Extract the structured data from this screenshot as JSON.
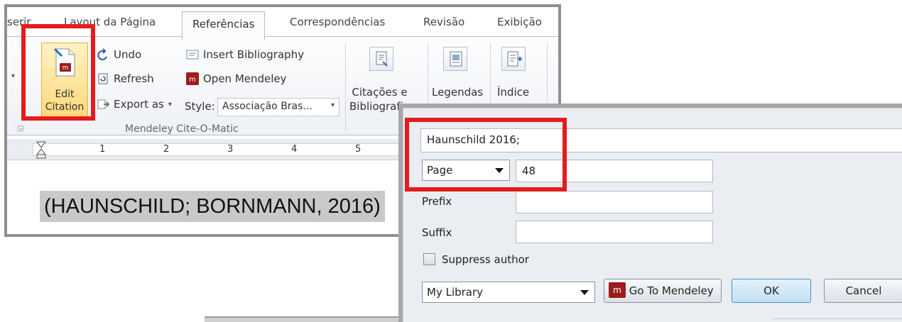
{
  "tabs": [
    "serir",
    "Layout da Página",
    "Referências",
    "Correspondências",
    "Revisão",
    "Exibição"
  ],
  "ribbon": {
    "edit_citation_line1": "Edit",
    "edit_citation_line2": "Citation",
    "undo": "Undo",
    "refresh": "Refresh",
    "export_as": "Export as",
    "insert_bibliography": "Insert Bibliography",
    "open_mendeley": "Open Mendeley",
    "style_label": "Style:",
    "style_value": "Associação Bras...",
    "group_label": "Mendeley Cite-O-Matic",
    "citacoes_line1": "Citações e",
    "citacoes_line2": "Bibliografia",
    "legendas": "Legendas",
    "indice": "Índice"
  },
  "ruler": {
    "numbers": [
      "1",
      "2",
      "3",
      "4",
      "5"
    ]
  },
  "document": {
    "citation_text": "(HAUNSCHILD; BORNMANN, 2016)"
  },
  "dialog": {
    "citation_field": "Haunschild 2016;",
    "locator_type": "Page",
    "locator_value": "48",
    "prefix_label": "Prefix",
    "suffix_label": "Suffix",
    "suppress_author": "Suppress author",
    "library": "My Library",
    "go_to_mendeley": "Go To Mendeley",
    "ok": "OK",
    "cancel": "Cancel"
  },
  "colors": {
    "highlight": "#e51c1c",
    "mendeley_red": "#9c1c1c",
    "selection": "#c9c9c9"
  },
  "icons": [
    "undo-icon",
    "refresh-icon",
    "export-icon",
    "insert-bibliography-icon",
    "mendeley-icon",
    "edit-citation-icon"
  ]
}
